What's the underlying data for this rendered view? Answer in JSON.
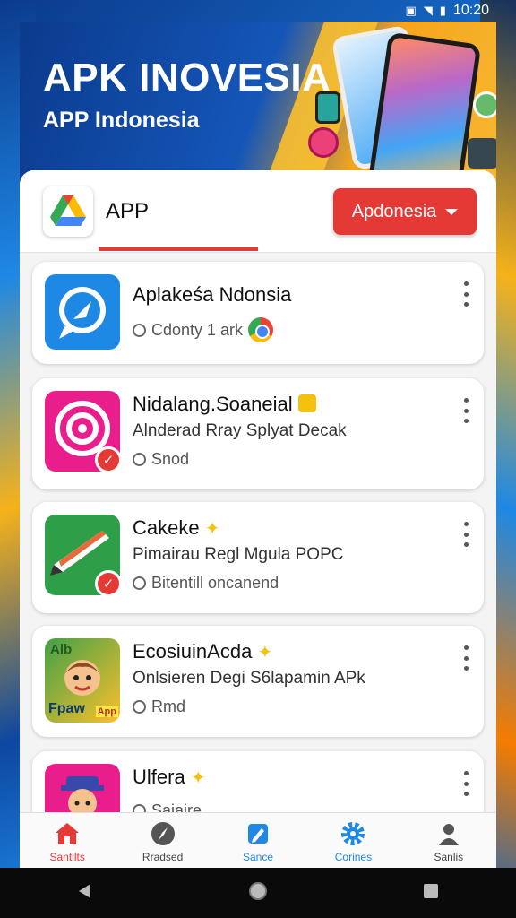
{
  "status_bar": {
    "time": "10:20",
    "icons": [
      "signal-icon",
      "wifi-icon",
      "battery-icon"
    ]
  },
  "hero": {
    "title": "APK INOVESIA",
    "subtitle": "APP Indonesia"
  },
  "header": {
    "title": "APP",
    "region_button": "Apdonesia"
  },
  "apps": [
    {
      "name": "Aplakeśa Ndonsia",
      "description": "",
      "meta": "Cdonty 1 ark",
      "icon": "chat-icon",
      "icon_color": "#1e88e5",
      "badge": "chrome-icon"
    },
    {
      "name": "Nidalang.Soaneial",
      "description": "Alnderad Rray Splyat Decak",
      "meta": "Snod",
      "icon": "target-icon",
      "icon_color": "#e91e8c",
      "badge": "lock-icon"
    },
    {
      "name": "Cakeke",
      "description": "Pimairau Regl Mgula POPC",
      "meta": "Bitentill oncanend",
      "icon": "pencil-icon",
      "icon_color": "#2e9e48",
      "badge": "star-icon"
    },
    {
      "name": "EcosiuinAcda",
      "description": "Onlsieren Degi S6lapamin APk",
      "meta": "Rmd",
      "icon": "kid-avatar-icon",
      "icon_color": "#4caf50",
      "badge": "star-icon"
    },
    {
      "name": "Ulfera",
      "description": "",
      "meta": "Saiaire",
      "icon": "character-icon",
      "icon_color": "#e91e8c",
      "badge": "star-icon"
    }
  ],
  "app4_icon_text": {
    "top": "Alb",
    "bottom": "Fpaw",
    "corner": "App"
  },
  "bottom_nav": [
    {
      "label": "Santilts",
      "icon": "home-icon",
      "color": "#e53935"
    },
    {
      "label": "Rradsed",
      "icon": "compass-icon",
      "color": "#555555"
    },
    {
      "label": "Sance",
      "icon": "edit-icon",
      "color": "#1e88e5"
    },
    {
      "label": "Corines",
      "icon": "gear-icon",
      "color": "#1e88e5"
    },
    {
      "label": "Sanlis",
      "icon": "person-icon",
      "color": "#555555"
    }
  ],
  "colors": {
    "accent": "#e53935",
    "primary_blue": "#1e88e5"
  }
}
